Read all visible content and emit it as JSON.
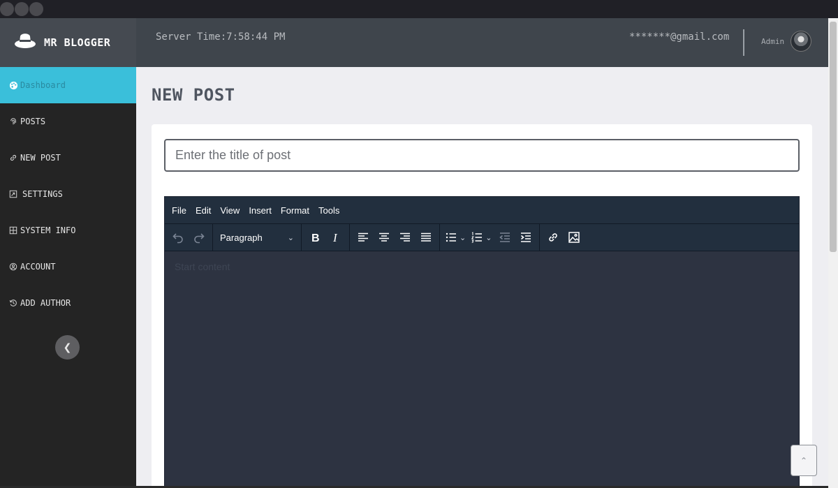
{
  "header": {
    "brand_name": "MR BLOGGER",
    "server_time": "Server Time:7:58:44 PM",
    "email": "*******@gmail.com",
    "role": "Admin"
  },
  "sidebar": {
    "items": [
      {
        "label": "Dashboard",
        "icon": "palette-icon",
        "active": true
      },
      {
        "label": "POSTS",
        "icon": "fingerprint-icon"
      },
      {
        "label": "NEW POST",
        "icon": "link-icon"
      },
      {
        "label": "SETTINGS",
        "icon": "settings-icon"
      },
      {
        "label": "SYSTEM INFO",
        "icon": "grid-icon"
      },
      {
        "label": "ACCOUNT",
        "icon": "user-circle-icon"
      },
      {
        "label": "ADD AUTHOR",
        "icon": "history-icon"
      }
    ]
  },
  "main": {
    "title": "NEW POST",
    "title_placeholder": "Enter the title of post",
    "editor": {
      "menu": [
        "File",
        "Edit",
        "View",
        "Insert",
        "Format",
        "Tools"
      ],
      "block_format": "Paragraph",
      "content_placeholder": "Start content"
    }
  },
  "colors": {
    "active_nav": "#3abfda",
    "editor_bg": "#2d3341",
    "editor_toolbar": "#222f3e"
  }
}
